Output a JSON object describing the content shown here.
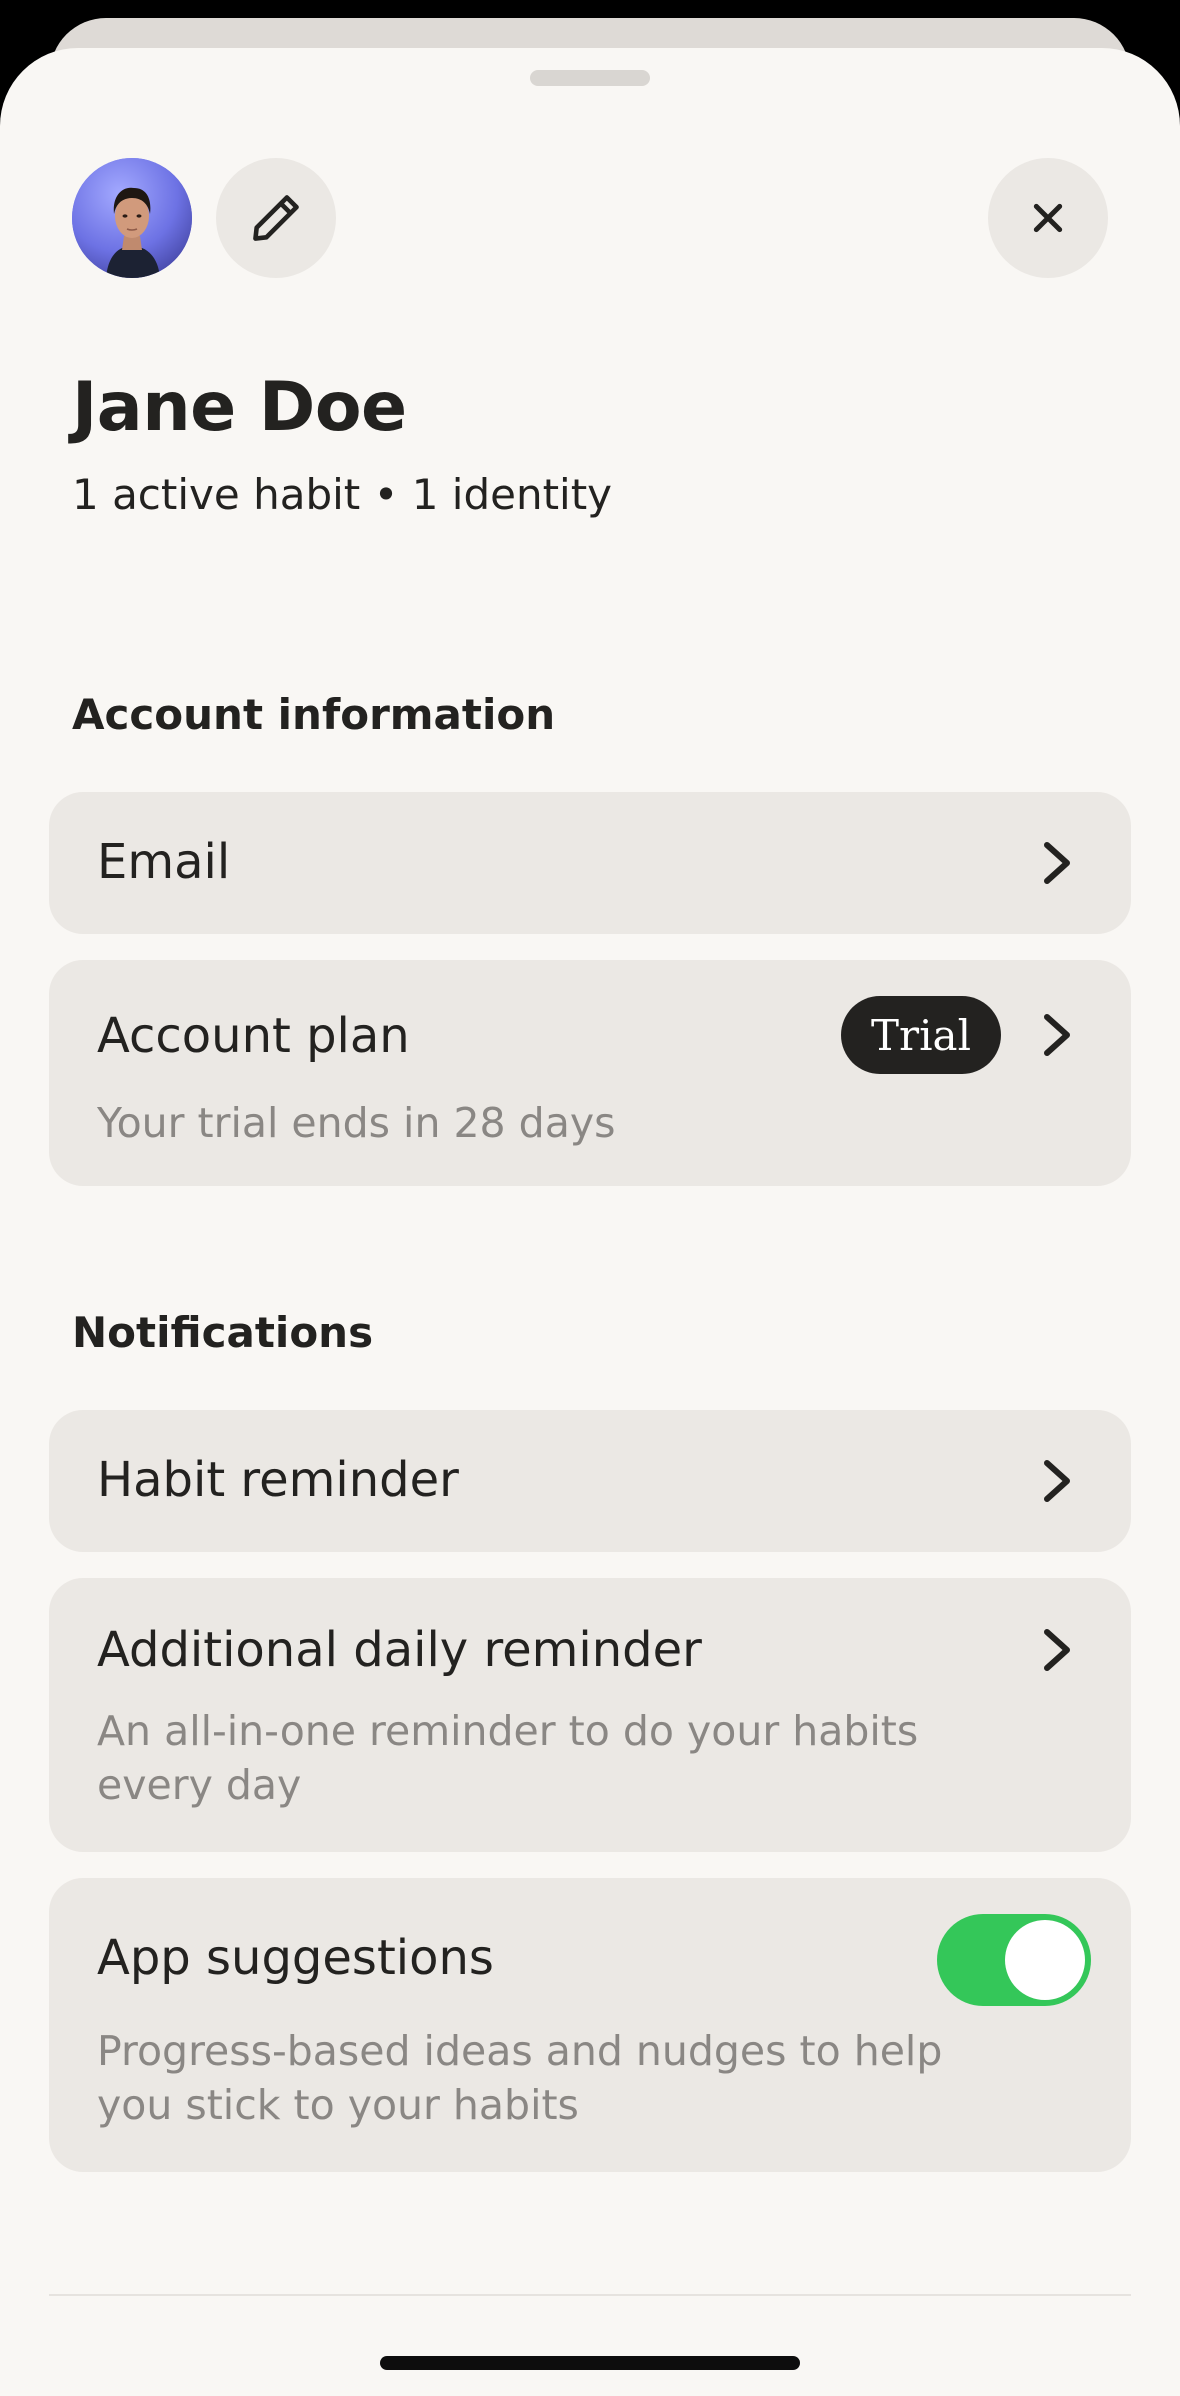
{
  "profile": {
    "name": "Jane Doe",
    "stats": "1 active habit • 1 identity"
  },
  "icons": {
    "avatar": "user-photo",
    "edit": "pencil-icon",
    "close": "close-icon",
    "chevron": "chevron-right-icon"
  },
  "account": {
    "section_title": "Account information",
    "email_label": "Email",
    "plan_label": "Account plan",
    "plan_badge": "Trial",
    "plan_subtitle": "Your trial ends in 28 days"
  },
  "notifications": {
    "section_title": "Notifications",
    "habit_reminder_label": "Habit reminder",
    "daily_reminder_label": "Additional daily reminder",
    "daily_reminder_subtitle": "An all-in-one reminder to do your habits every day",
    "suggestions_label": "App suggestions",
    "suggestions_subtitle": "Progress-based ideas and nudges to help you stick to your habits",
    "suggestions_enabled": true
  },
  "colors": {
    "sheet_background": "#f9f7f4",
    "card_background": "#ebe8e4",
    "text_primary": "#232220",
    "text_secondary": "#8a8784",
    "toggle_on": "#34c759",
    "badge_background": "#232220"
  }
}
